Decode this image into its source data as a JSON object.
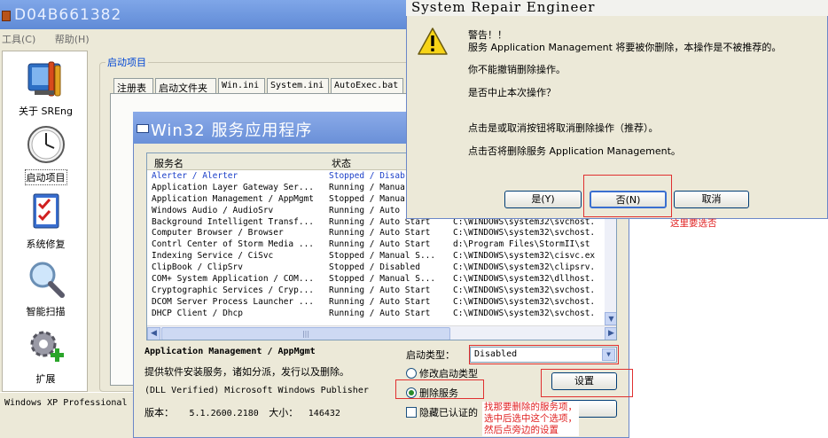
{
  "main_window": {
    "title": "D04B661382",
    "menu": [
      "工具(C)",
      "帮助(H)"
    ],
    "sidebar": [
      {
        "label": "关于 SREng",
        "icon": "tools-icon"
      },
      {
        "label": "启动项目",
        "icon": "clock-icon"
      },
      {
        "label": "系统修复",
        "icon": "checklist-icon"
      },
      {
        "label": "智能扫描",
        "icon": "magnifier-icon"
      },
      {
        "label": "扩展",
        "icon": "gear-plus-icon"
      }
    ],
    "group_label": "启动项目",
    "tabs": [
      "注册表",
      "启动文件夹",
      "Win.ini",
      "System.ini",
      "AutoExec.bat"
    ],
    "status": "Windows XP Professional"
  },
  "services_dialog": {
    "title": "Win32 服务应用程序",
    "columns": [
      "服务名",
      "状态"
    ],
    "rows": [
      {
        "name": "Alerter / Alerter",
        "status": "Stopped / Disab",
        "path": ""
      },
      {
        "name": "Application Layer Gateway Ser...",
        "status": "Running / Manua",
        "path": ""
      },
      {
        "name": "Application Management / AppMgmt",
        "status": "Stopped / Manua",
        "path": ""
      },
      {
        "name": "Windows Audio / AudioSrv",
        "status": "Running / Auto",
        "path": ""
      },
      {
        "name": "Background Intelligent Transf...",
        "status": "Running / Auto Start",
        "path": "C:\\WINDOWS\\system32\\svchost."
      },
      {
        "name": "Computer Browser / Browser",
        "status": "Running / Auto Start",
        "path": "C:\\WINDOWS\\system32\\svchost."
      },
      {
        "name": "Contrl Center of Storm Media ...",
        "status": "Running / Auto Start",
        "path": "d:\\Program Files\\StormII\\st"
      },
      {
        "name": "Indexing Service / CiSvc",
        "status": "Stopped / Manual S...",
        "path": "C:\\WINDOWS\\system32\\cisvc.ex"
      },
      {
        "name": "ClipBook / ClipSrv",
        "status": "Stopped / Disabled",
        "path": "C:\\WINDOWS\\system32\\clipsrv."
      },
      {
        "name": "COM+ System Application / COM...",
        "status": "Stopped / Manual S...",
        "path": "C:\\WINDOWS\\system32\\dllhost."
      },
      {
        "name": "Cryptographic Services / Cryp...",
        "status": "Running / Auto Start",
        "path": "C:\\WINDOWS\\system32\\svchost."
      },
      {
        "name": "DCOM Server Process Launcher ...",
        "status": "Running / Auto Start",
        "path": "C:\\WINDOWS\\system32\\svchost."
      },
      {
        "name": "DHCP Client / Dhcp",
        "status": "Running / Auto Start",
        "path": "C:\\WINDOWS\\system32\\svchost."
      }
    ],
    "selected_name": "Application Management / AppMgmt",
    "description": "提供软件安装服务，诸如分派，发行以及删除。",
    "publisher": "(DLL Verified) Microsoft Windows Publisher",
    "version_label": "版本：",
    "version": "5.1.2600.2180",
    "size_label": "大小：",
    "size": "146432",
    "startup_type_label": "启动类型：",
    "startup_type_value": "Disabled",
    "radio_modify": "修改启动类型",
    "radio_delete": "删除服务",
    "hide_checkbox": "隐藏已认证的",
    "settings_button": "设置"
  },
  "repair_dialog": {
    "title": "System Repair Engineer",
    "lines": [
      "警告！！",
      "服务 Application Management 将要被你删除，本操作是不被推荐的。",
      "你不能撤销删除操作。",
      "是否中止本次操作？",
      "点击是或取消按钮将取消删除操作（推荐）。",
      "点击否将删除服务 Application Management。"
    ],
    "buttons": [
      "是(Y)",
      "否(N)",
      "取消"
    ]
  },
  "annotations": {
    "choose_no": "这里要选否",
    "instruction": [
      "找那要删除的服务项，",
      "选中后选中这个选项，",
      "然后点旁边的设置"
    ]
  },
  "colors": {
    "annotation_red": "#e02020",
    "xp_blue": "#0046d5"
  }
}
